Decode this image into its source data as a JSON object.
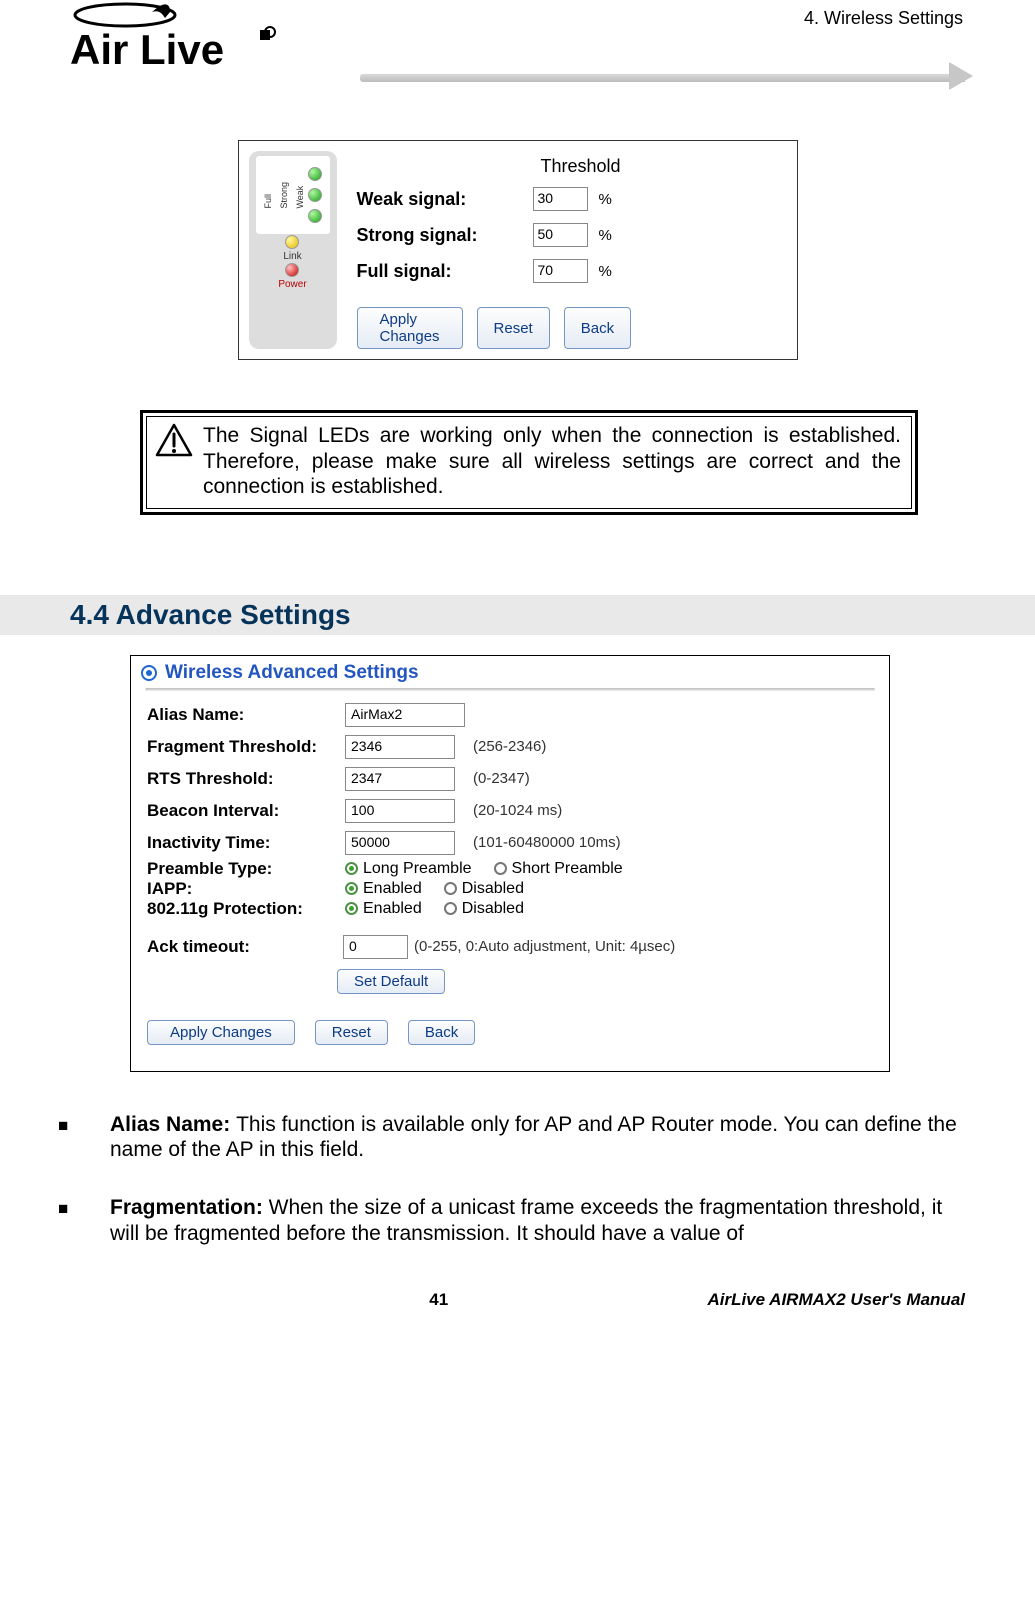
{
  "header": {
    "section": "4. Wireless Settings",
    "brand_alt": "Air Live"
  },
  "threshold": {
    "header": "Threshold",
    "rows": [
      {
        "label": "Weak signal:",
        "value": "30",
        "unit": "%"
      },
      {
        "label": "Strong signal:",
        "value": "50",
        "unit": "%"
      },
      {
        "label": "Full signal:",
        "value": "70",
        "unit": "%"
      }
    ],
    "buttons": {
      "apply": "Apply Changes",
      "reset": "Reset",
      "back": "Back"
    },
    "leds": {
      "signal_labels": [
        "Full",
        "Strong",
        "Weak"
      ],
      "link_label": "Link",
      "power_label": "Power"
    }
  },
  "warning": {
    "text": "The Signal LEDs are working only when the connection is established.   Therefore, please make sure all wireless settings are correct and the connection is established."
  },
  "section_heading": "4.4 Advance  Settings",
  "adv": {
    "title": "Wireless Advanced Settings",
    "alias": {
      "label": "Alias Name:",
      "value": "AirMax2"
    },
    "frag": {
      "label": "Fragment Threshold:",
      "value": "2346",
      "range": "(256-2346)"
    },
    "rts": {
      "label": "RTS Threshold:",
      "value": "2347",
      "range": "(0-2347)"
    },
    "beacon": {
      "label": "Beacon Interval:",
      "value": "100",
      "range": "(20-1024 ms)"
    },
    "inactivity": {
      "label": "Inactivity Time:",
      "value": "50000",
      "range": "(101-60480000 10ms)"
    },
    "preamble": {
      "label": "Preamble Type:",
      "opt1": "Long Preamble",
      "opt2": "Short Preamble"
    },
    "iapp": {
      "label": "IAPP:",
      "opt1": "Enabled",
      "opt2": "Disabled"
    },
    "prot": {
      "label": "802.11g Protection:",
      "opt1": "Enabled",
      "opt2": "Disabled"
    },
    "ack": {
      "label": "Ack timeout:",
      "value": "0",
      "range": "(0-255, 0:Auto adjustment, Unit: 4µsec)",
      "set_default": "Set Default"
    },
    "buttons": {
      "apply": "Apply Changes",
      "reset": "Reset",
      "back": "Back"
    }
  },
  "paras": {
    "p1_label": "Alias Name: ",
    "p1_text": "This function is available only for AP and AP Router mode.   You can define the name of the AP in this field.",
    "p2_label": "Fragmentation: ",
    "p2_text": "When the size of a unicast frame exceeds the fragmentation threshold, it will be fragmented before the transmission. It should have a value of"
  },
  "footer": {
    "page": "41",
    "right": "AirLive AIRMAX2 User's Manual"
  }
}
